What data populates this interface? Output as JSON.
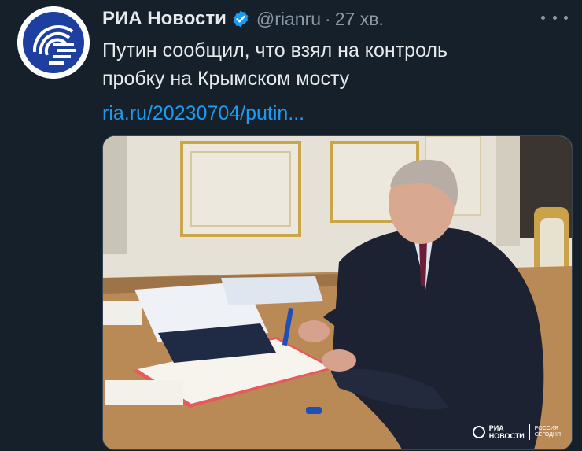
{
  "tweet": {
    "author_name": "РИА Новости",
    "handle": "@rianru",
    "separator": "·",
    "time": "27 хв.",
    "text_line1": "Путин сообщил, что взял на контроль",
    "text_line2": "пробку на Крымском мосту",
    "link_text": "ria.ru/20230704/putin..."
  },
  "media": {
    "watermark_line1": "РИА",
    "watermark_line2": "НОВОСТИ",
    "watermark_sub1": "РОССИЯ",
    "watermark_sub2": "СЕГОДНЯ"
  },
  "colors": {
    "background": "#15202b",
    "text": "#e7e9ea",
    "muted": "#8b98a5",
    "link": "#1d9bf0",
    "verified": "#1d9bf0",
    "avatar_brand": "#1c3fa0"
  },
  "icons": [
    "ria-logo-icon",
    "verified-badge-icon",
    "more-options-icon"
  ]
}
